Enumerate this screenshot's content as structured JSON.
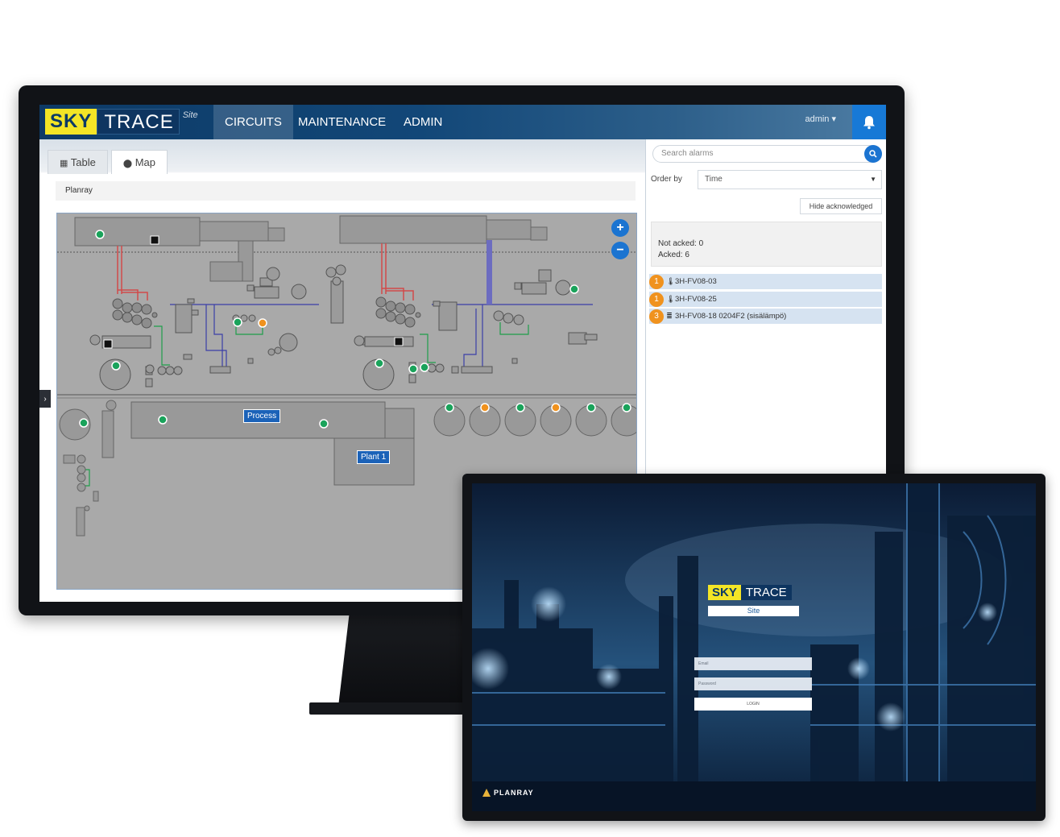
{
  "app": {
    "brand": {
      "sky": "SKY",
      "trace": "TRACE",
      "site": "Site"
    },
    "nav": {
      "items": [
        {
          "label": "CIRCUITS",
          "active": true
        },
        {
          "label": "MAINTENANCE",
          "active": false
        },
        {
          "label": "ADMIN",
          "active": false
        }
      ]
    },
    "user": "admin ▾",
    "bell_icon": "bell-icon"
  },
  "view": {
    "tabs": [
      {
        "label": "Table",
        "icon": "table-icon",
        "active": false
      },
      {
        "label": "Map",
        "icon": "map-marker-icon",
        "active": true
      }
    ],
    "breadcrumb": "Planray",
    "zoom_in": "+",
    "zoom_out": "−",
    "sidebar_toggle": "›"
  },
  "map": {
    "labels": {
      "process": "Process",
      "plant": "Plant 1"
    },
    "colors": {
      "ok": "#1aa35b",
      "warning": "#f0921e",
      "equipment": "#8f8f8f",
      "pipe_red": "#d14a4a",
      "pipe_blue": "#3b3fa8",
      "pipe_green": "#1e9e4a",
      "link": "#1b74d1"
    }
  },
  "alarms": {
    "search_placeholder": "Search alarms",
    "order_label": "Order by",
    "order_value": "Time",
    "hide_ack_label": "Hide acknowledged",
    "not_acked": "Not acked: 0",
    "acked": "Acked: 6",
    "items": [
      {
        "count": "1",
        "icon": "thermometer-icon",
        "name": "3H-FV08-03"
      },
      {
        "count": "1",
        "icon": "thermometer-icon",
        "name": "3H-FV08-25"
      },
      {
        "count": "3",
        "icon": "database-icon",
        "name": "3H-FV08-18 0204F2 (sisälämpö)"
      }
    ]
  },
  "login": {
    "brand": {
      "sky": "SKY",
      "trace": "TRACE",
      "site": "Site"
    },
    "email_placeholder": "Email",
    "password_placeholder": "Password",
    "login_label": "LOGIN",
    "footer_brand": "PLANRAY"
  }
}
